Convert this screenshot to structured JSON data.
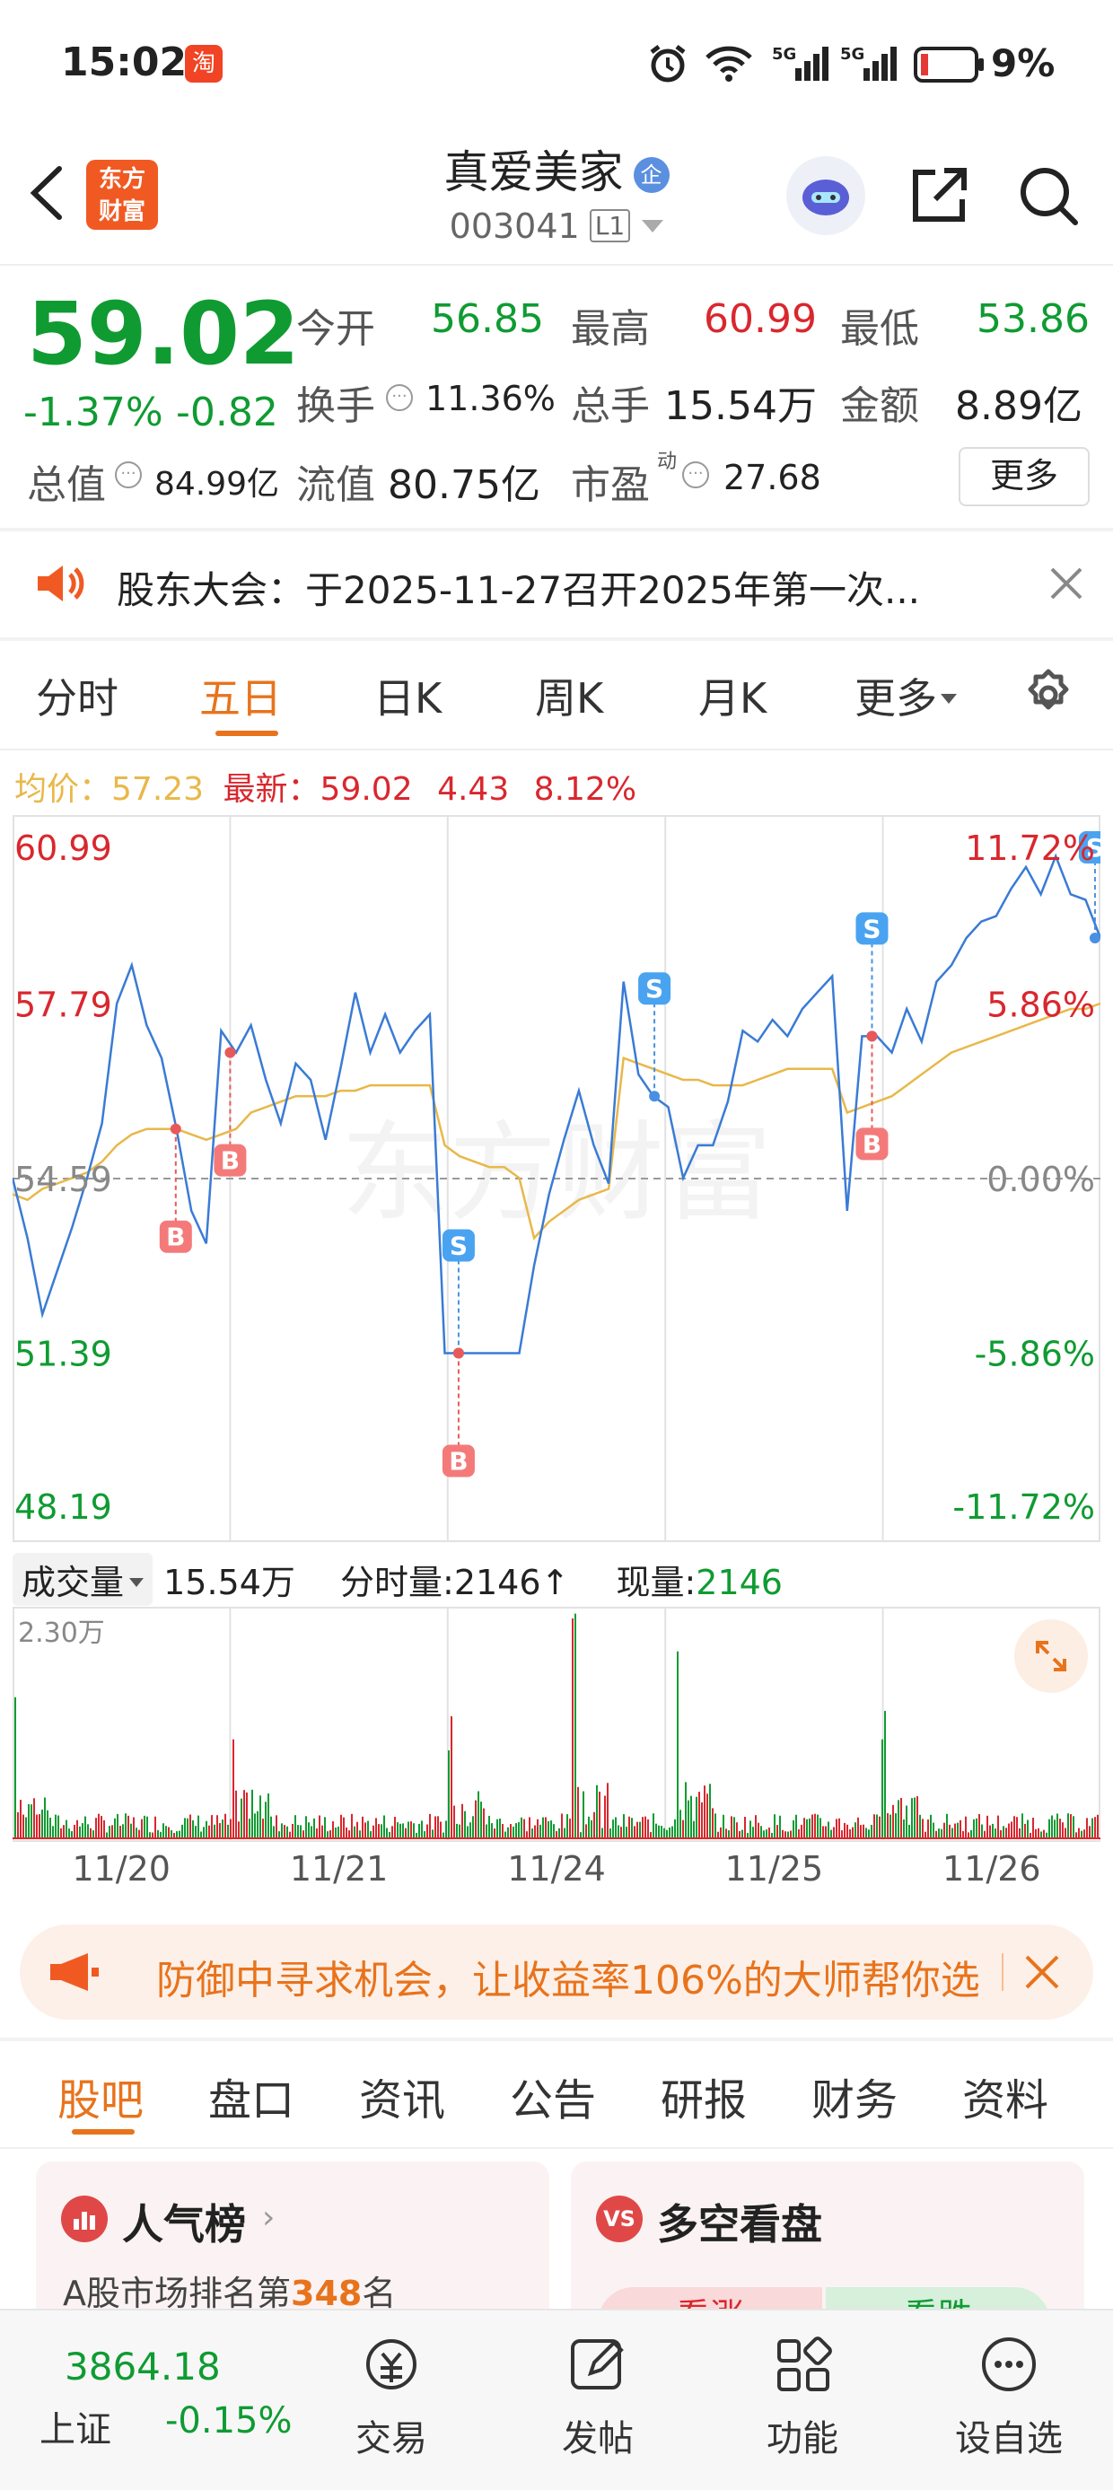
{
  "status_bar": {
    "time": "15:02",
    "battery": "9%",
    "net1": "5G",
    "net2": "5G"
  },
  "header": {
    "stock_name": "真爱美家",
    "badge": "企",
    "code": "003041",
    "level": "L1",
    "logo_line1": "东方",
    "logo_line2": "财富"
  },
  "quote": {
    "price": "59.02",
    "change_pct": "-1.37%",
    "change": "-0.82",
    "open_label": "今开",
    "open": "56.85",
    "high_label": "最高",
    "high": "60.99",
    "low_label": "最低",
    "low": "53.86",
    "turnover_label": "换手",
    "turnover": "11.36%",
    "volume_label": "总手",
    "volume": "15.54万",
    "amount_label": "金额",
    "amount": "8.89亿",
    "mcap_label": "总值",
    "mcap": "84.99亿",
    "float_label": "流值",
    "float_value": "80.75亿",
    "pe_label": "市盈",
    "pe_sup": "动",
    "pe": "27.68",
    "more": "更多"
  },
  "notice": {
    "text": "股东大会：于2025-11-27召开2025年第一次..."
  },
  "chart_tabs": [
    "分时",
    "五日",
    "日K",
    "周K",
    "月K",
    "更多"
  ],
  "chart_info": {
    "avg_label": "均价：",
    "avg": "57.23",
    "latest_label": "最新：",
    "latest": "59.02",
    "chg": "4.43",
    "chg_pct": "8.12%"
  },
  "chart_data": {
    "type": "line",
    "y_labels_left": [
      "60.99",
      "57.79",
      "54.59",
      "51.39",
      "48.19"
    ],
    "y_labels_right": [
      "11.72%",
      "5.86%",
      "0.00%",
      "-5.86%",
      "-11.72%"
    ],
    "ylim": [
      48.19,
      60.99
    ],
    "prev_close": 54.59,
    "days": [
      "11/20",
      "11/21",
      "11/24",
      "11/25",
      "11/26"
    ],
    "series": [
      {
        "values": [
          54.6,
          53.5,
          52.1,
          52.9,
          53.7,
          54.6,
          55.6,
          57.8,
          58.5,
          57.4,
          56.8,
          55.5,
          54.0,
          53.4,
          57.3,
          56.9,
          57.4,
          56.4,
          55.6,
          56.7,
          56.4,
          55.3,
          56.6,
          58.0,
          56.9,
          57.6,
          56.9,
          57.3,
          57.6,
          51.39,
          51.39,
          51.39,
          51.39,
          51.39,
          51.39,
          53.0,
          54.3,
          55.3,
          56.2,
          55.2,
          54.5,
          58.2,
          56.5,
          56.1,
          55.9,
          54.6,
          55.2,
          55.2,
          56.0,
          57.3,
          57.1,
          57.5,
          57.2,
          57.7,
          58.0,
          58.3,
          54.0,
          57.2,
          57.2,
          56.9,
          57.7,
          57.1,
          58.2,
          58.5,
          59.0,
          59.3,
          59.4,
          59.9,
          60.3,
          59.8,
          60.5,
          59.8,
          59.7,
          59.0
        ]
      },
      {
        "values": [
          54.3,
          54.2,
          54.4,
          54.5,
          54.6,
          54.7,
          54.9,
          55.2,
          55.4,
          55.5,
          55.5,
          55.5,
          55.4,
          55.3,
          55.4,
          55.5,
          55.8,
          55.9,
          56.0,
          56.1,
          56.1,
          56.1,
          56.2,
          56.2,
          56.3,
          56.3,
          56.3,
          56.3,
          56.3,
          55.2,
          55.0,
          54.9,
          54.8,
          54.8,
          54.6,
          53.5,
          53.8,
          54.0,
          54.2,
          54.3,
          54.4,
          56.8,
          56.7,
          56.6,
          56.5,
          56.4,
          56.4,
          56.3,
          56.3,
          56.3,
          56.4,
          56.5,
          56.6,
          56.6,
          56.6,
          56.6,
          55.8,
          55.9,
          56.0,
          56.1,
          56.3,
          56.5,
          56.7,
          56.9,
          57.0,
          57.1,
          57.2,
          57.3,
          57.4,
          57.5,
          57.6,
          57.7,
          57.7,
          57.8
        ]
      }
    ]
  },
  "trade_marks": [
    "B",
    "B",
    "S",
    "B",
    "S",
    "S",
    "B",
    "S"
  ],
  "volume": {
    "label": "成交量",
    "total": "15.54万",
    "minute_label": "分时量:",
    "minute": "2146",
    "cur_label": "现量:",
    "cur": "2146",
    "max": "2.30万"
  },
  "ad": {
    "text": "防御中寻求机会，让收益率106%的大师帮你选"
  },
  "bottom_tabs": [
    "股吧",
    "盘口",
    "资讯",
    "公告",
    "研报",
    "财务",
    "资料"
  ],
  "cards": {
    "left_title": "人气榜",
    "left_sub_prefix": "A股市场排名第",
    "left_rank": "348",
    "left_sub_suffix": "名",
    "right_title": "多空看盘",
    "right_up": "看涨",
    "right_down": "看跌"
  },
  "bottom_nav": {
    "index_value": "3864.18",
    "index_name": "上证",
    "index_chg": "-0.15%",
    "trade": "交易",
    "post": "发帖",
    "func": "功能",
    "watch": "设自选"
  },
  "colors": {
    "up": "#d9272e",
    "down": "#0f9b32",
    "accent": "#e8731c",
    "avg_line": "#e8b84a",
    "price_line": "#3a7bd5"
  }
}
